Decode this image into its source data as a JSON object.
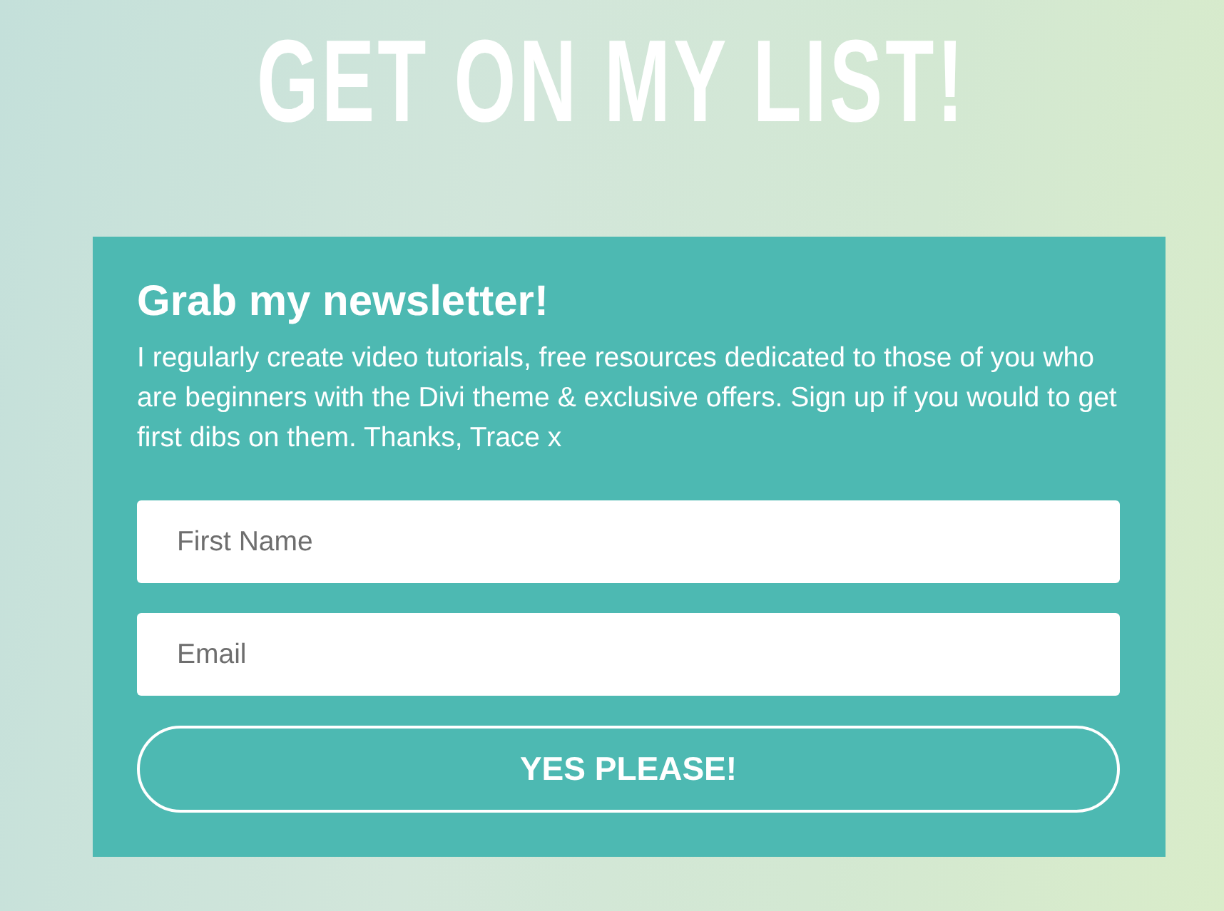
{
  "heading": "GET ON MY LIST!",
  "signup_card": {
    "title": "Grab my newsletter!",
    "description": "I regularly create video tutorials, free resources dedicated to those of you who are beginners with the Divi theme & exclusive offers. Sign up if you would to get first dibs on them. Thanks, Trace x",
    "fields": [
      {
        "placeholder": "First Name"
      },
      {
        "placeholder": "Email"
      }
    ],
    "submit_button": "YES PLEASE!"
  }
}
